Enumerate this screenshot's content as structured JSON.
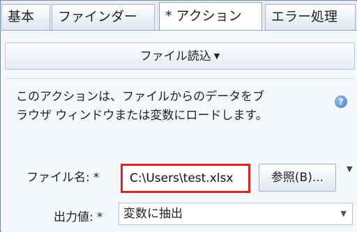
{
  "tabs": [
    {
      "label": "基本"
    },
    {
      "label": "ファインダー"
    },
    {
      "label": "* アクション"
    },
    {
      "label": "エラー処理"
    }
  ],
  "action": {
    "name": "ファイル読込",
    "description_line1": "このアクションは、ファイルからのデータをブ",
    "description_line2": "ラウザ ウィンドウまたは変数にロードします。"
  },
  "fields": {
    "file_name_label": "ファイル名:",
    "file_name_value": "C:\\Users\\test.xlsx",
    "browse_label": "参照(B)...",
    "output_label": "出力値:",
    "output_value": "変数に抽出",
    "required_mark": "*"
  },
  "icons": {
    "help": "?",
    "dropdown": "▼"
  },
  "colors": {
    "highlight": "#e0201c",
    "help_icon": "#3f78c4"
  }
}
